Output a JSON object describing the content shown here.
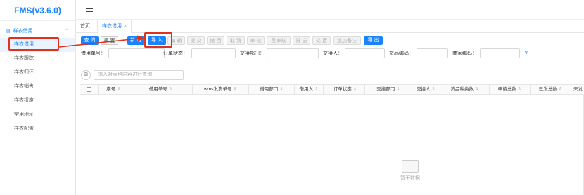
{
  "app": {
    "title": "FMS(v3.6.0)"
  },
  "sidebar": {
    "group_label": "样衣借用",
    "items": [
      {
        "label": "样衣借用",
        "active": true
      },
      {
        "label": "样衣跟踪"
      },
      {
        "label": "样衣归还"
      },
      {
        "label": "样衣销售"
      },
      {
        "label": "样衣报废"
      },
      {
        "label": "常用地址"
      },
      {
        "label": "样衣配置"
      }
    ]
  },
  "tabs": [
    {
      "label": "首页"
    },
    {
      "label": "样衣借用",
      "close": "×"
    }
  ],
  "toolbar": {
    "buttons": [
      {
        "label": "查 询",
        "style": "primary"
      },
      {
        "label": "重 置",
        "style": "plain"
      },
      {
        "label": "新 增",
        "style": "primary"
      },
      {
        "label": "导 入",
        "style": "primary"
      },
      {
        "label": "编 辑",
        "style": "disabled"
      },
      {
        "label": "提 交",
        "style": "disabled"
      },
      {
        "label": "撤 回",
        "style": "disabled"
      },
      {
        "label": "取 消",
        "style": "disabled"
      },
      {
        "label": "审 核",
        "style": "disabled"
      },
      {
        "label": "反审核",
        "style": "disabled"
      },
      {
        "label": "推 送",
        "style": "disabled"
      },
      {
        "label": "交 接",
        "style": "disabled"
      },
      {
        "label": "追加备注",
        "style": "disabled"
      },
      {
        "label": "导 出",
        "style": "primary"
      }
    ]
  },
  "filters": {
    "borrow_no_label": "借用单号：",
    "order_status_label": "订单状态：",
    "handover_dept_label": "交接部门：",
    "handover_person_label": "交接人：",
    "goods_code_label": "货品编码：",
    "merchant_code_label": "商家编码："
  },
  "search": {
    "placeholder": "输入对表格内容进行查询"
  },
  "table": {
    "columns": [
      "序号",
      "借用单号",
      "wms发货单号",
      "借用部门",
      "借用人",
      "订单状态",
      "交接部门",
      "交接人",
      "货品种类数",
      "申请总数",
      "已发总数",
      "未发"
    ],
    "empty_text": "暂无数据"
  },
  "colors": {
    "primary": "#1a84ff",
    "highlight": "#e0311e"
  }
}
